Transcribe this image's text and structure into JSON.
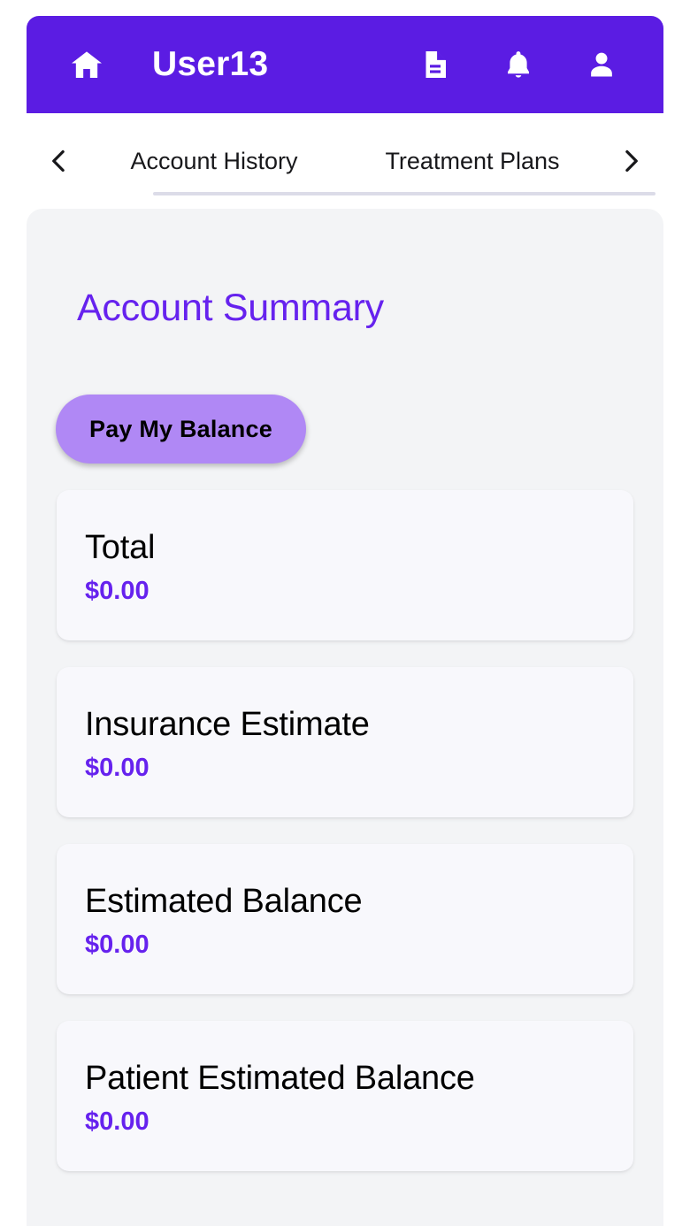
{
  "header": {
    "home_icon": "home-icon",
    "title": "User13",
    "actions": [
      {
        "icon": "document-icon",
        "name": "documents-button"
      },
      {
        "icon": "bell-icon",
        "name": "notifications-button"
      },
      {
        "icon": "person-icon",
        "name": "account-button"
      }
    ]
  },
  "tabs": {
    "prev_icon": "chevron-left-icon",
    "next_icon": "chevron-right-icon",
    "items": [
      {
        "label": "Account History"
      },
      {
        "label": "Treatment Plans"
      }
    ]
  },
  "main": {
    "page_title": "Account Summary",
    "pay_button_label": "Pay My Balance",
    "cards": [
      {
        "label": "Total",
        "value": "$0.00"
      },
      {
        "label": "Insurance Estimate",
        "value": "$0.00"
      },
      {
        "label": "Estimated Balance",
        "value": "$0.00"
      },
      {
        "label": "Patient Estimated Balance",
        "value": "$0.00"
      }
    ]
  },
  "colors": {
    "header_purple": "#5B1CE3",
    "accent_purple": "#6622EE",
    "button_purple": "#B088F5",
    "surface_gray": "#f3f4f6",
    "card_bg": "#f8f8fc"
  }
}
